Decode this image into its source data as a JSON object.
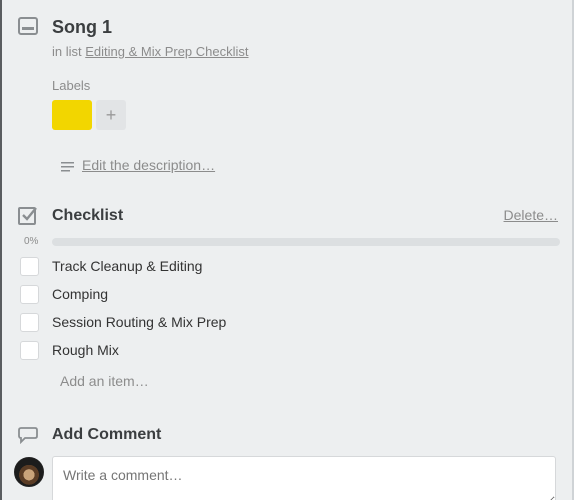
{
  "card": {
    "title": "Song 1",
    "in_list_prefix": "in list ",
    "list_name": "Editing & Mix Prep Checklist"
  },
  "labels": {
    "heading": "Labels",
    "items": [
      {
        "color": "#f2d600"
      }
    ],
    "add_label": "+"
  },
  "description": {
    "link_text": "Edit the description…"
  },
  "checklist": {
    "title": "Checklist",
    "delete_label": "Delete…",
    "progress_text": "0%",
    "progress_fraction": 0,
    "items": [
      {
        "text": "Track Cleanup & Editing",
        "checked": false
      },
      {
        "text": "Comping",
        "checked": false
      },
      {
        "text": "Session Routing & Mix Prep",
        "checked": false
      },
      {
        "text": "Rough Mix",
        "checked": false
      }
    ],
    "add_item": "Add an item…"
  },
  "comment": {
    "title": "Add Comment",
    "placeholder": "Write a comment…"
  },
  "icons": {
    "card": "card-icon",
    "description": "description-lines-icon",
    "checklist": "checkbox-icon",
    "comment": "speech-bubble-icon"
  }
}
